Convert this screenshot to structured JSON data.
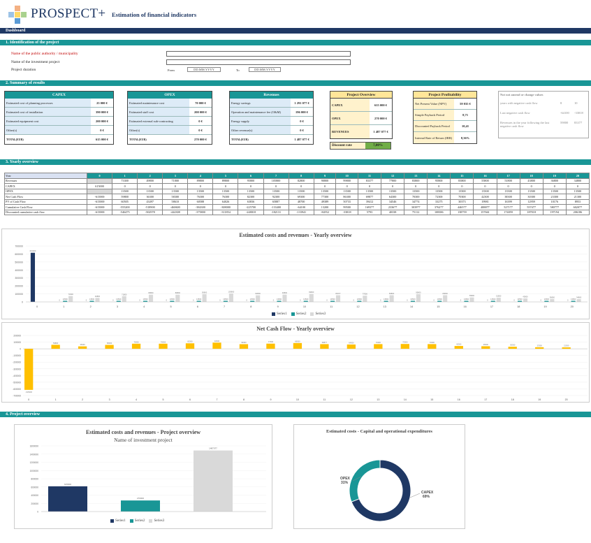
{
  "header": {
    "brand": "PROSPECT+",
    "title": "Estimation of financial indicators",
    "dashboard": "Dashboard"
  },
  "colors": {
    "navy": "#1f3864",
    "teal": "#199696",
    "yellow": "#ffe699",
    "gold": "#ffc000",
    "grey": "#d9d9d9",
    "green": "#70ad47"
  },
  "identification": {
    "section": "1. Identification of the project",
    "authority_label": "Name of the public authority / municipality",
    "project_label": "Name of the investment project",
    "duration_label": "Project duration",
    "from_label": "From",
    "to_label": "To",
    "from_value": "DD.MM.YYYY",
    "to_value": "DD.MM.YYYY"
  },
  "summary": {
    "section": "2. Summary of results",
    "capex": {
      "title": "CAPEX",
      "rows": [
        {
          "k": "Estimated cost of planning processes",
          "v": "25 000 €"
        },
        {
          "k": "Estimated cost of installation",
          "v": "390 000 €"
        },
        {
          "k": "Estimated equipment cost",
          "v": "200 000 €"
        },
        {
          "k": "Other(s)",
          "v": "0 €"
        }
      ],
      "total_k": "TOTAL(EUR)",
      "total_v": "615 000 €"
    },
    "opex": {
      "title": "OPEX",
      "rows": [
        {
          "k": "Estimated maintenance cost",
          "v": "70 000 €"
        },
        {
          "k": "Estimated staff cost",
          "v": "200 000 €"
        },
        {
          "k": "Estimated external sub-contracting",
          "v": "0 €"
        },
        {
          "k": "Other(s)",
          "v": "0 €"
        }
      ],
      "total_k": "TOTAL(EUR)",
      "total_v": "270 000 €"
    },
    "revenues": {
      "title": "Revenues",
      "rows": [
        {
          "k": "Energy savings",
          "v": "1 291 077 €"
        },
        {
          "k": "Operation and maintenance fee (O&M)",
          "v": "196 000 €"
        },
        {
          "k": "Energy supply",
          "v": "0 €"
        },
        {
          "k": "Other revenue(s)",
          "v": "0 €"
        }
      ],
      "total_k": "TOTAL(EUR)",
      "total_v": "1 487 077 €"
    },
    "overview": {
      "title": "Project Overview",
      "rows": [
        {
          "k": "CAPEX",
          "v": "615 000 €"
        },
        {
          "k": "OPEX",
          "v": "270 000 €"
        },
        {
          "k": "REVENUES",
          "v": "1 487 077 €"
        }
      ],
      "discount_label": "Discount rate",
      "discount_value": "7,00%"
    },
    "profitability": {
      "title": "Project Profitability",
      "rows": [
        {
          "k": "Net Present Value (NPV)",
          "v": "59 035 €"
        },
        {
          "k": "Simple Payback Period",
          "v": "8,71"
        },
        {
          "k": "Discounted Payback Period",
          "v": "10,41"
        },
        {
          "k": "Internal Rate of Return (IRR)",
          "v": "8,36%"
        }
      ]
    },
    "side": {
      "title": "Not not amend or change values",
      "rows": [
        {
          "k": "years with negative cash flow",
          "a": "8",
          "b": "10"
        },
        {
          "k": "Last negative cash flow",
          "a": "-64100",
          "b": "-33818"
        },
        {
          "k": "Revenues in the year following the last negative cash flow",
          "a": "59800",
          "b": "83377"
        }
      ]
    }
  },
  "yearly": {
    "section": "3. Yearly overview",
    "row_labels": [
      "Year",
      "Revenues",
      "CAPEX",
      "OPEX",
      "Net Cash Flow",
      "PV of Cash Flow",
      "Cumulative Cash Flow",
      "Discounted cumulative cash flow"
    ],
    "years": [
      "0",
      "1",
      "2",
      "3",
      "4",
      "5",
      "6",
      "7",
      "8",
      "9",
      "10",
      "11",
      "12",
      "13",
      "14",
      "15",
      "16",
      "17",
      "18",
      "19",
      "20"
    ],
    "revenues": [
      "",
      "73300",
      "49800",
      "71800",
      "89800",
      "89800",
      "95800",
      "105800",
      "82800",
      "90800",
      "99800",
      "83377",
      "77800",
      "83800",
      "95800",
      "83800",
      "55800",
      "51800",
      "43800",
      "36800",
      "34800"
    ],
    "capex": [
      "615000",
      "0",
      "0",
      "0",
      "0",
      "0",
      "0",
      "0",
      "0",
      "0",
      "0",
      "0",
      "0",
      "0",
      "0",
      "0",
      "0",
      "0",
      "0",
      "0",
      "0"
    ],
    "opex": [
      "",
      "13500",
      "13500",
      "13500",
      "13500",
      "13500",
      "13500",
      "13500",
      "13500",
      "13500",
      "13500",
      "13500",
      "13500",
      "13500",
      "13500",
      "13500",
      "13500",
      "13500",
      "13500",
      "13500",
      "13500"
    ],
    "ncf": [
      "-615000",
      "59800",
      "36300",
      "58300",
      "76300",
      "76300",
      "82300",
      "92300",
      "69300",
      "77300",
      "86300",
      "69877",
      "64300",
      "70300",
      "72300",
      "70300",
      "42300",
      "38300",
      "30300",
      "23300",
      "21300"
    ],
    "pv": [
      "-615000",
      "60505",
      "43497",
      "58610",
      "60588",
      "64026",
      "63836",
      "65887",
      "48700",
      "49389",
      "50733",
      "39412",
      "34546",
      "34774",
      "33275",
      "30373",
      "19981",
      "16399",
      "12959",
      "10176",
      "8953"
    ],
    "cum": [
      "-615000",
      "-555200",
      "-518900",
      "-460600",
      "-384300",
      "-308000",
      "-225700",
      "-133400",
      "-64100",
      "13200",
      "99500",
      "169377",
      "233677",
      "303977",
      "376277",
      "446577",
      "488877",
      "527177",
      "557477",
      "580777",
      "602077"
    ],
    "dcum": [
      "-615000",
      "-546475",
      "-502978",
      "-444308",
      "-375800",
      "-311854",
      "-248018",
      "-182131",
      "-133941",
      "-84552",
      "-33818",
      "5793",
      "40338",
      "75112",
      "108386",
      "138759",
      "157661",
      "174059",
      "187018",
      "197194",
      "206186"
    ]
  },
  "chart_data": [
    {
      "type": "bar",
      "title": "Estimated costs and revenues - Yearly overview",
      "categories": [
        "0",
        "1",
        "2",
        "3",
        "4",
        "5",
        "6",
        "7",
        "8",
        "9",
        "10",
        "11",
        "12",
        "13",
        "14",
        "15",
        "16",
        "17",
        "18",
        "19",
        "20"
      ],
      "series": [
        {
          "name": "Series1",
          "values": [
            615000,
            0,
            0,
            0,
            0,
            0,
            0,
            0,
            0,
            0,
            0,
            0,
            0,
            0,
            0,
            0,
            0,
            0,
            0,
            0,
            0
          ]
        },
        {
          "name": "Series2",
          "values": [
            0,
            13500,
            13500,
            13500,
            13500,
            13500,
            13500,
            13500,
            13500,
            13500,
            13500,
            13500,
            13500,
            13500,
            13500,
            13500,
            13500,
            13500,
            13500,
            13500,
            13500
          ]
        },
        {
          "name": "Series3",
          "values": [
            0,
            73300,
            49800,
            71800,
            89800,
            89800,
            95800,
            105800,
            82800,
            90800,
            99800,
            83377,
            77800,
            83800,
            95800,
            83800,
            55800,
            51800,
            43800,
            36800,
            34800
          ]
        }
      ],
      "ylim": [
        0,
        700000
      ],
      "yticks": [
        "0",
        "100000",
        "200000",
        "300000",
        "400000",
        "500000",
        "600000",
        "700000"
      ]
    },
    {
      "type": "bar",
      "title": "Net Cash Flow  - Yearly overview",
      "categories": [
        "0",
        "1",
        "2",
        "3",
        "4",
        "5",
        "6",
        "7",
        "8",
        "9",
        "10",
        "11",
        "12",
        "13",
        "14",
        "15",
        "16",
        "17",
        "18",
        "19",
        "20"
      ],
      "series": [
        {
          "values": [
            -615000,
            59800,
            36300,
            58300,
            76300,
            76300,
            82300,
            92300,
            69300,
            77300,
            86300,
            69877,
            64300,
            70300,
            72300,
            70300,
            42300,
            38300,
            30300,
            23300,
            21300
          ]
        }
      ],
      "ylim": [
        -700000,
        200000
      ],
      "yticks": [
        "200000",
        "100000",
        "0",
        "-100000",
        "-200000",
        "-300000",
        "-400000",
        "-500000",
        "-600000",
        "-700000"
      ]
    },
    {
      "type": "bar",
      "title": "Estimated costs and revenues - Project overview",
      "subtitle": "Name of investment project",
      "categories": [
        "CAPEX",
        "OPEX",
        "Revenues"
      ],
      "series": [
        {
          "name": "Series1",
          "values": [
            615000
          ]
        },
        {
          "name": "Series2",
          "values": [
            270000
          ]
        },
        {
          "name": "Series3",
          "values": [
            1487077
          ]
        }
      ],
      "ylim": [
        0,
        1600000
      ],
      "yticks": [
        "0",
        "200000",
        "400000",
        "600000",
        "800000",
        "1000000",
        "1200000",
        "1400000",
        "1600000"
      ],
      "data_labels": [
        "615000",
        "270000",
        "1487077"
      ]
    },
    {
      "type": "pie",
      "title": "Estimated costs - Capital and operational expenditures",
      "slices": [
        {
          "label": "CAPEX",
          "pct": "69%",
          "value": 0.69
        },
        {
          "label": "OPEX",
          "pct": "31%",
          "value": 0.31
        }
      ]
    }
  ],
  "project": {
    "section": "4. Project overview"
  }
}
